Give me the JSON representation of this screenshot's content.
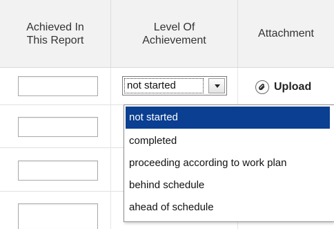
{
  "table": {
    "headers": {
      "achieved_line1": "Achieved In",
      "achieved_line2": "This Report",
      "level_line1": "Level Of",
      "level_line2": "Achievement",
      "attachment": "Attachment"
    },
    "row1": {
      "level_selected": "not started",
      "upload_label": "Upload"
    }
  },
  "dropdown": {
    "options": [
      "not started",
      "completed",
      "proceeding according to work plan",
      "behind schedule",
      "ahead of schedule"
    ],
    "selected_index": 0
  },
  "colors": {
    "header_bg": "#f2f2f2",
    "selected_option_bg": "#0a3f91"
  },
  "icons": {
    "upload": "paperclip-icon",
    "select_arrow": "chevron-down-icon"
  }
}
